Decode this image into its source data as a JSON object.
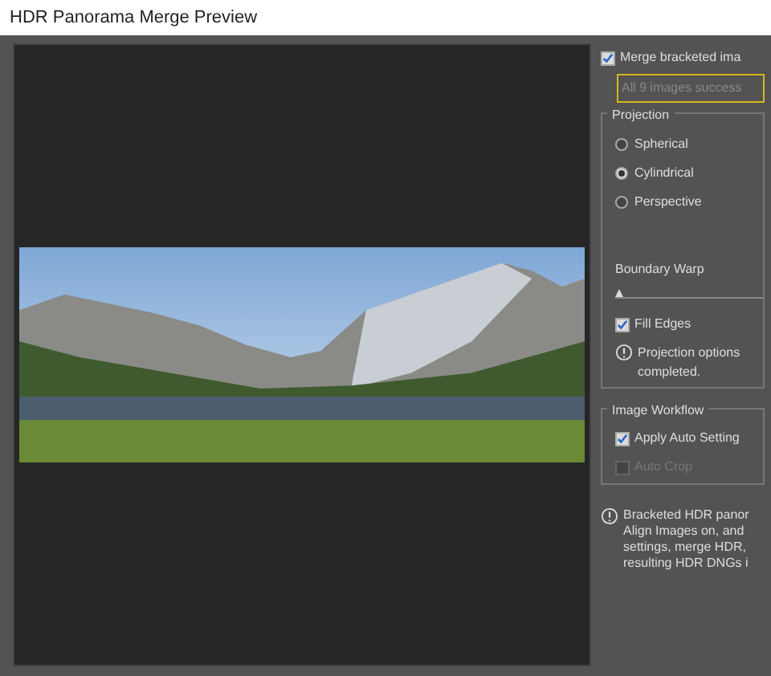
{
  "window": {
    "title": "HDR Panorama Merge Preview"
  },
  "options": {
    "merge_checkbox": {
      "label": "Merge bracketed ima",
      "checked": true
    },
    "status": "All 9 images success",
    "projection": {
      "title": "Projection",
      "items": [
        {
          "label": "Spherical",
          "selected": false
        },
        {
          "label": "Cylindrical",
          "selected": true
        },
        {
          "label": "Perspective",
          "selected": false
        }
      ]
    },
    "boundary_warp": {
      "label": "Boundary Warp",
      "level": 0
    },
    "fill_edges": {
      "label": "Fill Edges",
      "checked": true
    },
    "info": [
      "Projection options",
      "completed."
    ],
    "workflow": {
      "title": "Image Workflow",
      "items": [
        {
          "label": "Apply Auto Setting",
          "checked": true,
          "disabled": false
        },
        {
          "label": "Auto Crop",
          "checked": false,
          "disabled": true
        }
      ]
    },
    "note": [
      "Bracketed HDR panor",
      "Align Images on, and",
      "settings, merge HDR,",
      "resulting HDR DNGs i"
    ]
  }
}
